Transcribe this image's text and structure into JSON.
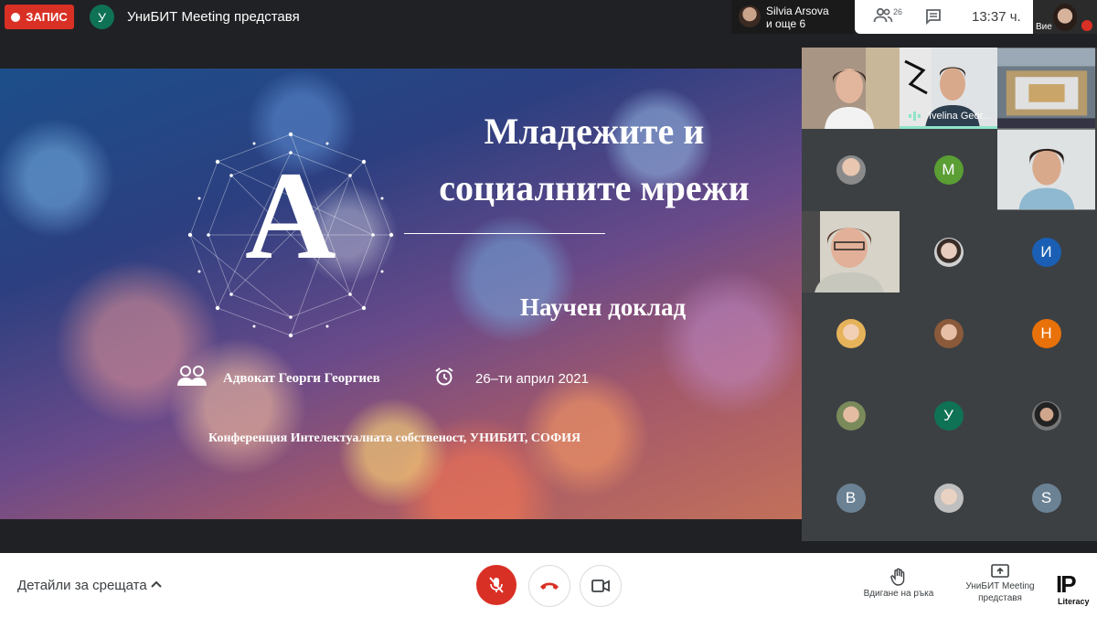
{
  "top_bar": {
    "record_label": "ЗАПИС",
    "presenter_initial": "У",
    "presenting_text": "УниБИТ Meeting представя",
    "people_strip": {
      "line1": "Silvia Arsova",
      "line2": "и още 6"
    },
    "participants_count": "26",
    "clock": "13:37 ч.",
    "self_label": "Вие"
  },
  "slide": {
    "letter": "A",
    "title_line1": "Младежите и",
    "title_line2": "социалните мрежи",
    "subtitle": "Научен доклад",
    "author": "Адвокат Георги Георгиев",
    "date": "26–ти април 2021",
    "conference": "Конференция Интелектуалната собственост, УНИБИТ, СОФИЯ"
  },
  "tiles": [
    {
      "kind": "video",
      "name": ""
    },
    {
      "kind": "video",
      "name": "Ivelina Geor..."
    },
    {
      "kind": "video",
      "name": ""
    },
    {
      "kind": "photo",
      "color": "#c9a38a"
    },
    {
      "kind": "initial",
      "initial": "M",
      "color": "#5a9e34"
    },
    {
      "kind": "video",
      "name": ""
    },
    {
      "kind": "video",
      "name": ""
    },
    {
      "kind": "photo",
      "color": "#e0c8b8"
    },
    {
      "kind": "initial",
      "initial": "И",
      "color": "#1a5fb4"
    },
    {
      "kind": "photo",
      "color": "#e8c070"
    },
    {
      "kind": "photo",
      "color": "#d4a080"
    },
    {
      "kind": "initial",
      "initial": "Н",
      "color": "#e8710a"
    },
    {
      "kind": "photo",
      "color": "#caa080"
    },
    {
      "kind": "initial",
      "initial": "У",
      "color": "#0f7254"
    },
    {
      "kind": "photo",
      "color": "#555555"
    },
    {
      "kind": "initial",
      "initial": "В",
      "color": "#6b8295"
    },
    {
      "kind": "photo",
      "color": "#d8c0b0"
    },
    {
      "kind": "initial",
      "initial": "S",
      "color": "#6b8295"
    }
  ],
  "bottom_bar": {
    "details_label": "Детайли за срещата",
    "raise_hand_label": "Вдигане на ръка",
    "present_label_line1": "УниБИТ Meeting",
    "present_label_line2": "представя",
    "logo_text": "IP",
    "logo_sub": "Literacy"
  },
  "colors": {
    "record": "#d93025",
    "mic_off": "#d93025",
    "speaking": "#8ee5c7"
  }
}
